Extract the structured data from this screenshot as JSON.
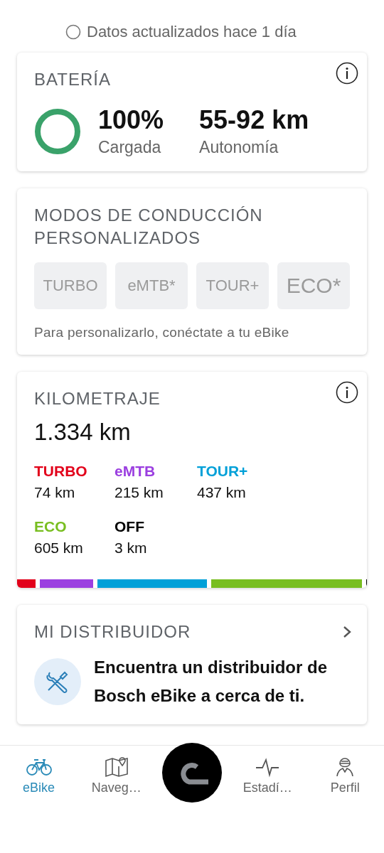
{
  "sync_status": "Datos actualizados hace 1 día",
  "battery": {
    "title": "BATERÍA",
    "charge": "100%",
    "charge_label": "Cargada",
    "range": "55-92 km",
    "range_label": "Autonomía"
  },
  "riding_modes": {
    "title": "MODOS DE CONDUCCIÓN PERSONALIZADOS",
    "modes": [
      {
        "label": "TURBO",
        "disabled": true
      },
      {
        "label": "eMTB*",
        "disabled": true
      },
      {
        "label": "TOUR+",
        "disabled": true
      },
      {
        "label": "ECO*",
        "disabled": true
      }
    ],
    "hint": "Para personalizarlo, conéctate a tu eBike"
  },
  "mileage": {
    "title": "KILOMETRAJE",
    "total": "1.334 km",
    "modes": [
      {
        "name": "TURBO",
        "value": "74 km",
        "color": "#e2001a"
      },
      {
        "name": "eMTB",
        "value": "215 km",
        "color": "#9b3fe0"
      },
      {
        "name": "TOUR+",
        "value": "437 km",
        "color": "#00a0d8"
      },
      {
        "name": "ECO",
        "value": "605 km",
        "color": "#78be20"
      },
      {
        "name": "OFF",
        "value": "3 km",
        "color": "#000000"
      }
    ]
  },
  "dealer": {
    "title": "MI DISTRIBUIDOR",
    "text": "Encuentra un distribuidor de Bosch eBike a cerca de ti."
  },
  "bottom_nav": [
    {
      "kind": "bike",
      "label": "eBike",
      "selected": true
    },
    {
      "kind": "map",
      "label": "Naveg…",
      "selected": false
    },
    {
      "kind": "center",
      "selected": false
    },
    {
      "kind": "pulse",
      "label": "Estadí…",
      "selected": false
    },
    {
      "kind": "rider",
      "label": "Perfil",
      "selected": false
    }
  ]
}
